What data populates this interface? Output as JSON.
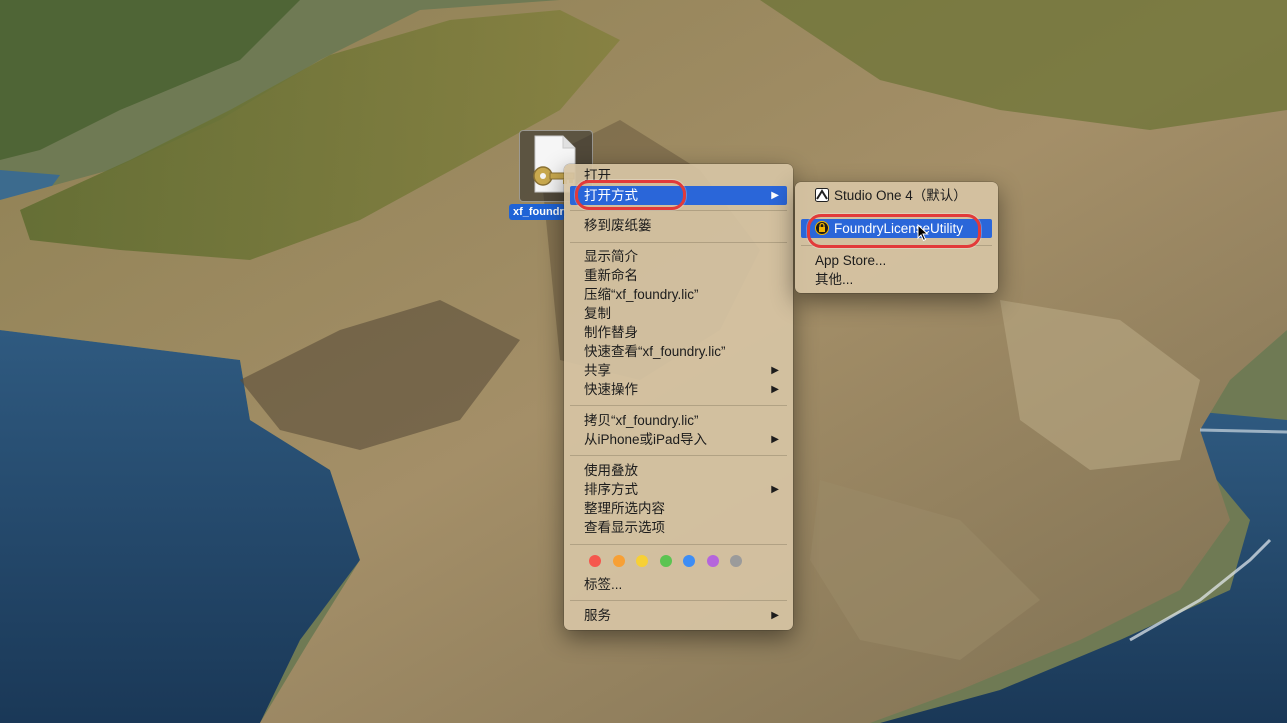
{
  "desktop": {
    "file": {
      "label": "xf_foundry.lic",
      "icon": "license-key-file-icon"
    }
  },
  "context_menu": {
    "items": [
      {
        "label": "打开"
      },
      {
        "label": "打开方式",
        "submenu": true,
        "highlighted": true
      },
      {
        "label": "移到废纸篓"
      },
      {
        "label": "显示简介"
      },
      {
        "label": "重新命名"
      },
      {
        "label": "压缩“xf_foundry.lic”"
      },
      {
        "label": "复制"
      },
      {
        "label": "制作替身"
      },
      {
        "label": "快速查看“xf_foundry.lic”"
      },
      {
        "label": "共享",
        "submenu": true
      },
      {
        "label": "快速操作",
        "submenu": true
      },
      {
        "label": "拷贝“xf_foundry.lic”"
      },
      {
        "label": "从iPhone或iPad导入",
        "submenu": true
      },
      {
        "label": "使用叠放"
      },
      {
        "label": "排序方式",
        "submenu": true
      },
      {
        "label": "整理所选内容"
      },
      {
        "label": "查看显示选项"
      },
      {
        "label": "标签..."
      },
      {
        "label": "服务",
        "submenu": true
      }
    ],
    "tag_colors": [
      "#f5574d",
      "#f7a035",
      "#f7d036",
      "#5bc451",
      "#3d8df5",
      "#b565dc",
      "#9b9b9b"
    ]
  },
  "submenu": {
    "items": [
      {
        "label": "Studio One 4（默认）",
        "icon": "studio-one-icon"
      },
      {
        "label": "FoundryLicenseUtility",
        "icon": "foundry-license-utility-icon",
        "highlighted": true
      },
      {
        "label": "App Store..."
      },
      {
        "label": "其他..."
      }
    ]
  },
  "colors": {
    "highlight": "#2a66d9",
    "menu_background": "#d6c4a4",
    "annotation": "#e23a3a"
  }
}
